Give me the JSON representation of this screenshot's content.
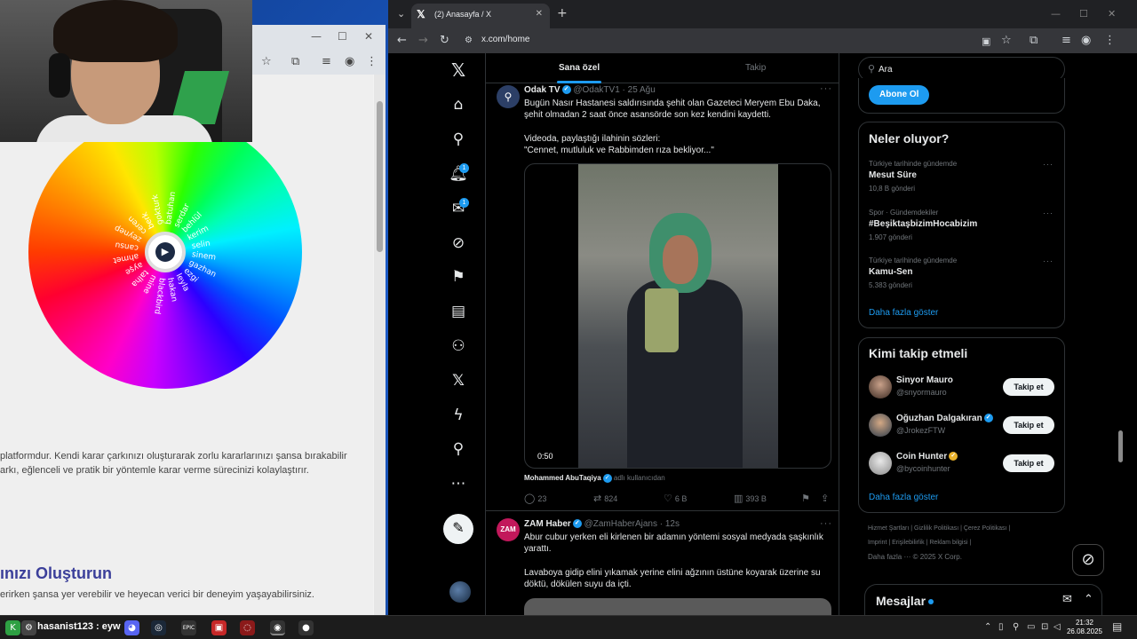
{
  "left_browser": {
    "controls": [
      "—",
      "☐",
      "✕"
    ],
    "wheel_labels": [
      "gokturk",
      "batuhan",
      "serdar",
      "behlül",
      "kerim",
      "selin",
      "sinem",
      "gazhan",
      "ezgi",
      "leyla",
      "hakan",
      "blackbird",
      "mine",
      "talha",
      "ayşe",
      "ahmet",
      "cansu",
      "zeynep",
      "ceren",
      "berk"
    ],
    "text_line_1": "platformdur. Kendi karar çarkınızı oluşturarak zorlu kararlarınızı şansa bırakabilir",
    "text_line_2": "arkı, eğlenceli ve pratik bir yöntemle karar verme sürecinizi kolaylaştırır.",
    "heading": "ınızı Oluşturun",
    "text_line_3": "erirken şansa yer verebilir ve heyecan verici bir deneyim yaşayabilirsiniz."
  },
  "right_browser": {
    "tab_title": "(2) Anasayfa / X",
    "url": "x.com/home",
    "new_tab": "+"
  },
  "nav": {
    "notification_badge": "1",
    "messages_badge": "1"
  },
  "feed": {
    "tabs": [
      "Sana özel",
      "Takip"
    ],
    "post1": {
      "name": "Odak TV",
      "handle": "@OdakTV1 · 25 Ağu",
      "line1": "Bugün Nasır Hastanesi saldırısında şehit olan  Gazeteci Meryem Ebu Daka,",
      "line2": "şehit olmadan 2 saat önce  asansörde son kez kendini kaydetti.",
      "line3": "Videoda, paylaştığı ilahinin sözleri:",
      "line4": "\"Cennet, mutluluk ve Rabbimden rıza bekliyor...\"",
      "video_time": "0:50",
      "caption_name": "Mohammed AbuTaqiya",
      "caption_sub": "adlı kullanıcıdan",
      "replies": "23",
      "reposts": "824",
      "likes": "6 B",
      "views": "393 B"
    },
    "post2": {
      "name": "ZAM Haber",
      "handle": "@ZamHaberAjans · 12s",
      "avatar_text": "ZAM",
      "line1": "Abur cubur yerken eli kirlenen bir adamın yöntemi sosyal medyada şaşkınlık",
      "line2": "yarattı.",
      "line3": "Lavaboya gidip elini yıkamak yerine elini ağzının üstüne koyarak üzerine su",
      "line4": "döktü, dökülen suyu da içti."
    }
  },
  "sidebar": {
    "search_placeholder": "Ara",
    "subscribe_button": "Abone Ol",
    "trends_title": "Neler oluyor?",
    "trends": [
      {
        "meta": "Türkiye tarihinde gündemde",
        "title": "Mesut Süre",
        "count": "10,8 B gönderi"
      },
      {
        "meta": "Spor · Gündemdekiler",
        "title": "#BeşiktaşbizimHocabizim",
        "count": "1.907 gönderi"
      },
      {
        "meta": "Türkiye tarihinde gündemde",
        "title": "Kamu-Sen",
        "count": "5.383 gönderi"
      }
    ],
    "show_more": "Daha fazla göster",
    "who_title": "Kimi takip etmeli",
    "who": [
      {
        "name": "Sinyor Mauro",
        "handle": "@snyormauro",
        "button": "Takip et"
      },
      {
        "name": "Oğuzhan Dalgakıran",
        "handle": "@JrokezFTW",
        "button": "Takip et"
      },
      {
        "name": "Coin Hunter",
        "handle": "@bycoinhunter",
        "button": "Takip et"
      }
    ],
    "footer_line1": "Hizmet Şartları  |  Gizlilik Politikası  |  Çerez Politikası  |",
    "footer_line2": "Imprint  |  Erişilebilirlik  |  Reklam bilgisi  |",
    "footer_line3": "Daha fazla ···   © 2025 X Corp.",
    "messages_title": "Mesajlar"
  },
  "taskbar": {
    "username": "hasanist123 : eyw",
    "time": "21:32",
    "date": "26.08.2025"
  },
  "colors": {
    "accent": "#1d9bf0",
    "x_bg": "#000000"
  }
}
